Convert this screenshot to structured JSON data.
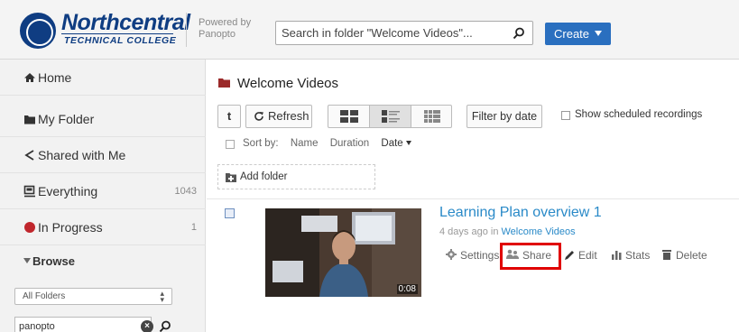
{
  "header": {
    "logo": {
      "name": "Northcentral",
      "subtitle": "TECHNICAL COLLEGE"
    },
    "powered_by": {
      "line1": "Powered by",
      "line2": "Panopto"
    },
    "search": {
      "placeholder": "Search in folder \"Welcome Videos\"...",
      "value": ""
    },
    "create_label": "Create"
  },
  "sidebar": {
    "items": [
      {
        "label": "Home",
        "icon": "home-icon",
        "count": ""
      },
      {
        "label": "My Folder",
        "icon": "folder-icon",
        "count": ""
      },
      {
        "label": "Shared with Me",
        "icon": "share-icon",
        "count": ""
      },
      {
        "label": "Everything",
        "icon": "everything-icon",
        "count": "1043"
      },
      {
        "label": "In Progress",
        "icon": "record-dot-icon",
        "count": "1"
      }
    ],
    "browse_label": "Browse",
    "folder_select": {
      "selected": "All Folders"
    },
    "folder_search": {
      "value": "panopto"
    }
  },
  "main": {
    "folder_title": "Welcome Videos",
    "toolbar": {
      "rss_label": "t",
      "refresh_label": "Refresh",
      "filter_label": "Filter by date",
      "scheduled_label": "Show scheduled recordings",
      "scheduled_checked": false,
      "active_view": "list"
    },
    "sort": {
      "label": "Sort by:",
      "options": [
        "Name",
        "Duration",
        "Date"
      ],
      "active": "Date"
    },
    "add_folder_label": "Add folder",
    "sessions": [
      {
        "title": "Learning Plan overview 1",
        "meta_prefix": "4 days ago in",
        "folder": "Welcome Videos",
        "duration": "0:08",
        "actions": {
          "settings": "Settings",
          "share": "Share",
          "edit": "Edit",
          "stats": "Stats",
          "delete": "Delete"
        }
      }
    ]
  },
  "colors": {
    "brand": "#0f3d82",
    "link": "#2a8ac8",
    "create_button": "#2a6fbf",
    "highlight": "#e00000",
    "in_progress_dot": "#c0262c"
  }
}
